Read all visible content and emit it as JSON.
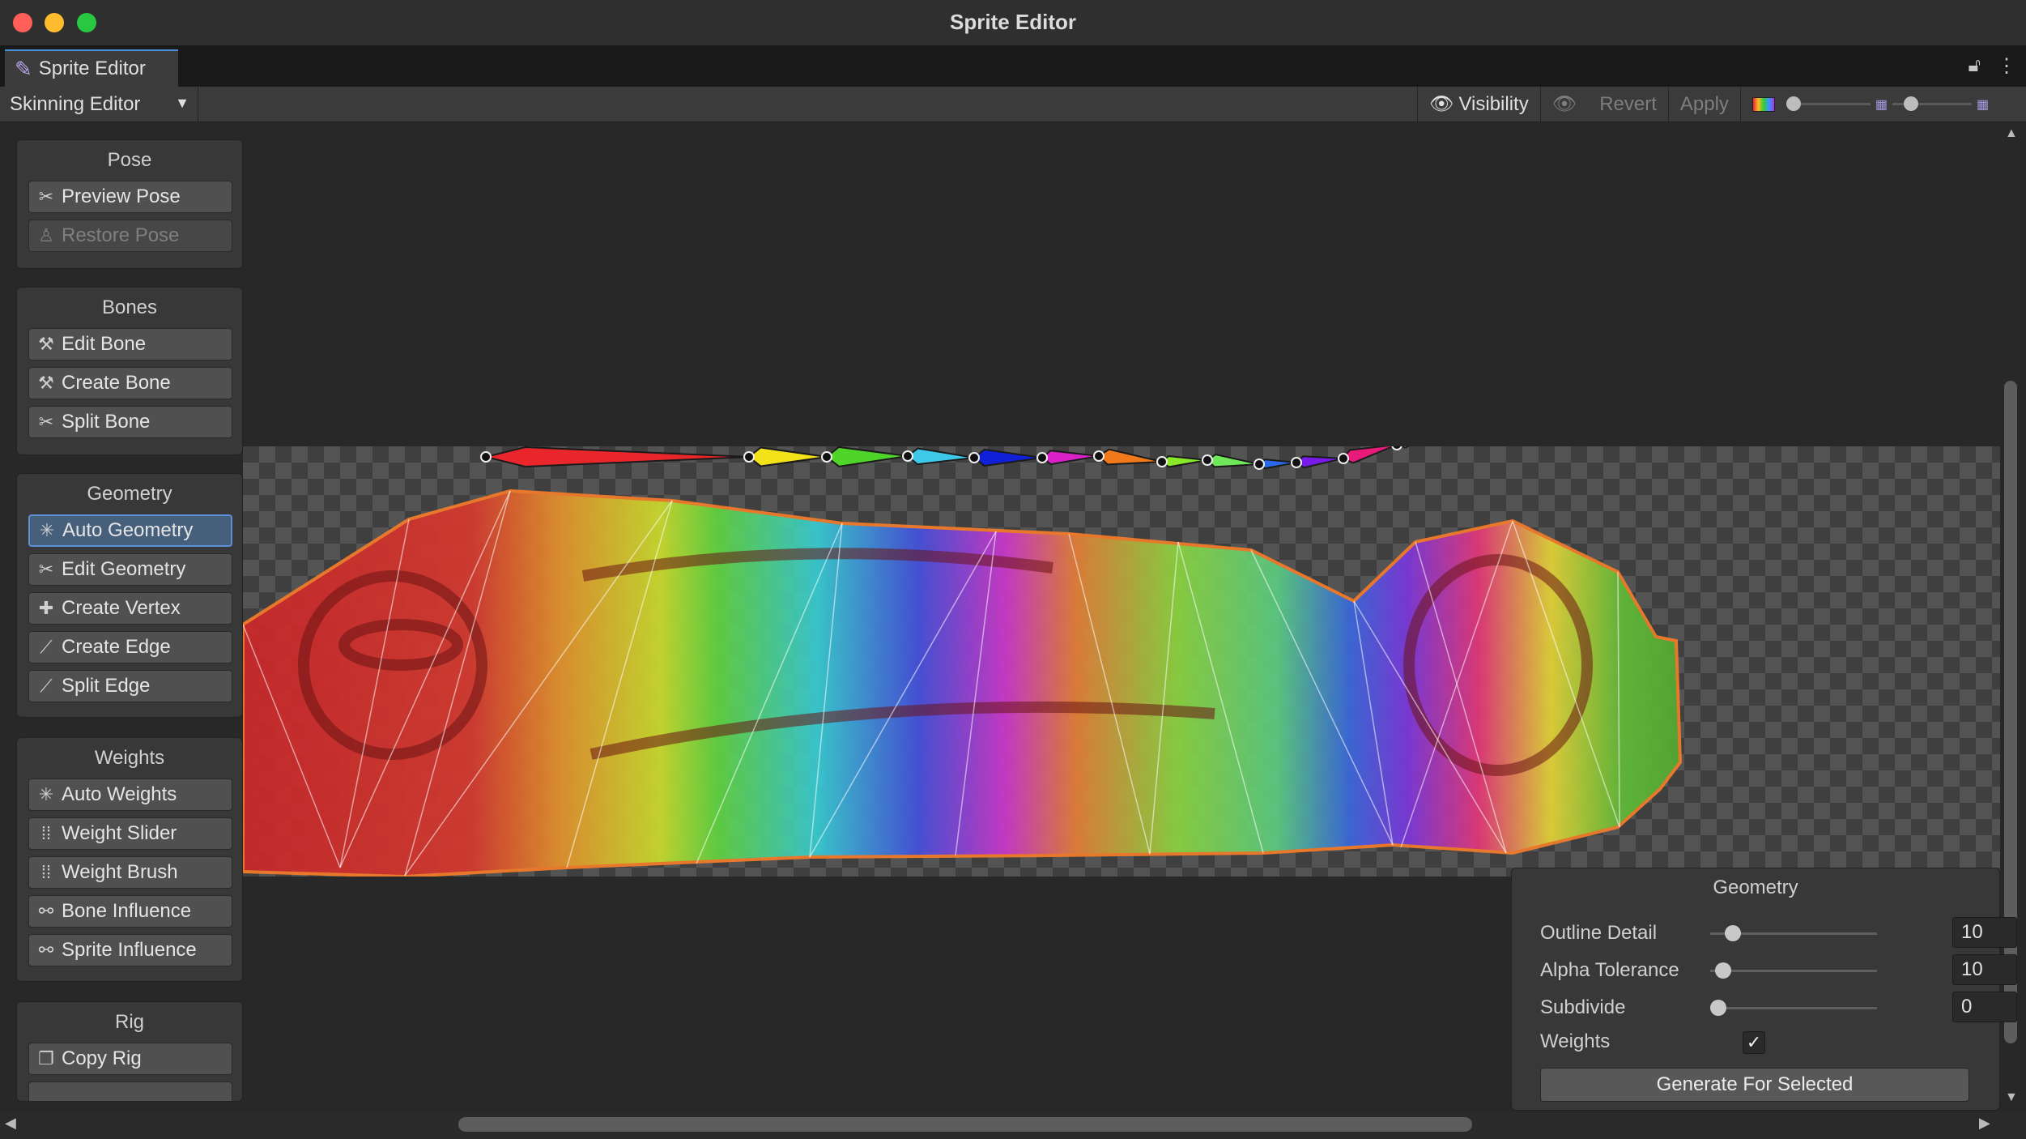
{
  "window": {
    "title": "Sprite Editor"
  },
  "tab": {
    "label": "Sprite Editor"
  },
  "toolbar": {
    "mode": "Skinning Editor",
    "visibility": "Visibility",
    "revert": "Revert",
    "apply": "Apply"
  },
  "pose": {
    "title": "Pose",
    "buttons": [
      "Preview Pose",
      "Restore Pose"
    ]
  },
  "bones": {
    "title": "Bones",
    "buttons": [
      "Edit Bone",
      "Create Bone",
      "Split Bone"
    ]
  },
  "geometry_tools": {
    "title": "Geometry",
    "buttons": [
      "Auto Geometry",
      "Edit Geometry",
      "Create Vertex",
      "Create Edge",
      "Split Edge"
    ]
  },
  "weights": {
    "title": "Weights",
    "buttons": [
      "Auto Weights",
      "Weight Slider",
      "Weight Brush",
      "Bone Influence",
      "Sprite Influence"
    ]
  },
  "rig": {
    "title": "Rig",
    "buttons": [
      "Copy Rig"
    ]
  },
  "geometry_panel": {
    "title": "Geometry",
    "outline_detail": {
      "label": "Outline Detail",
      "value": "10"
    },
    "alpha_tolerance": {
      "label": "Alpha Tolerance",
      "value": "10"
    },
    "subdivide": {
      "label": "Subdivide",
      "value": "0"
    },
    "weights": {
      "label": "Weights",
      "checked": true
    },
    "generate": "Generate For Selected"
  },
  "bones_colors": [
    "#e8262b",
    "#f2e21a",
    "#4fd42a",
    "#3ec9e8",
    "#1020d8",
    "#d822c8",
    "#f07a1a",
    "#88e82a",
    "#6ee85a",
    "#2a6ae8",
    "#7a1ae8",
    "#e81a7a",
    "#f2e83a",
    "#5ad82a"
  ]
}
